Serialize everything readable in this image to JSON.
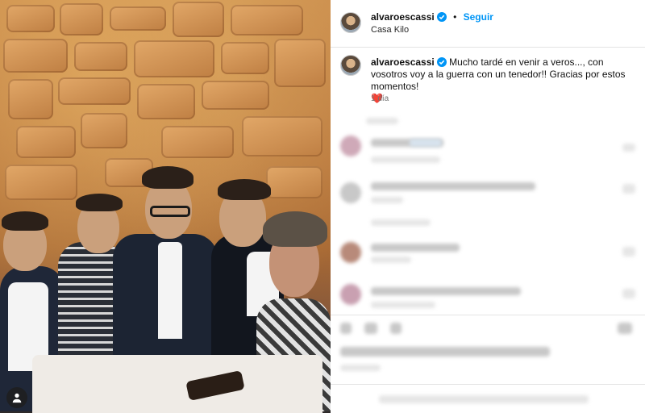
{
  "post": {
    "username": "alvaroescassi",
    "follow_label": "Seguir",
    "separator": "•",
    "location": "Casa Kilo",
    "caption": "Mucho tardé en venir a veros..., con vosotros voy a la guerra con un tenedor!! Gracias por estos momentos!",
    "caption_emoji": "❤️",
    "time_ago": "1 día"
  },
  "colors": {
    "follow": "#0095f6",
    "verified": "#0095f6",
    "heart": "#e0245e"
  },
  "icons": [
    "verified-badge-icon",
    "user-tag-icon"
  ]
}
